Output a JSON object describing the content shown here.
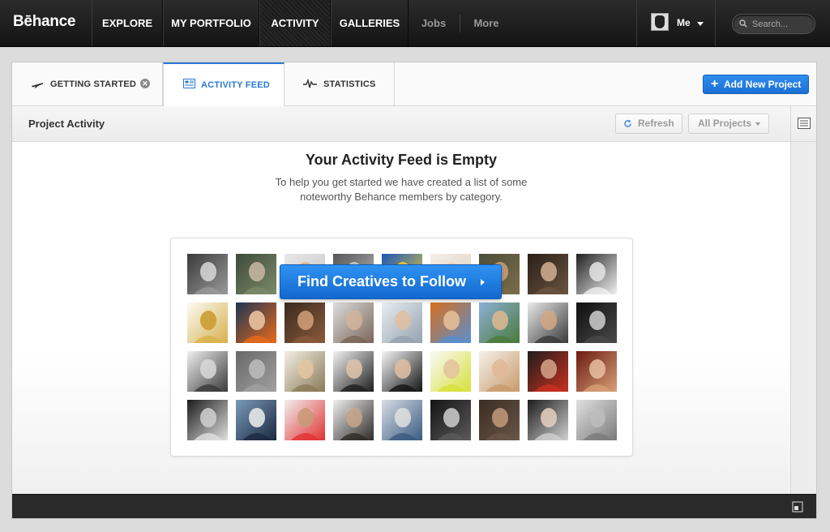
{
  "nav": {
    "logo": "Bēhance",
    "items": [
      {
        "label": "EXPLORE"
      },
      {
        "label": "MY PORTFOLIO"
      },
      {
        "label": "ACTIVITY"
      },
      {
        "label": "GALLERIES"
      },
      {
        "label": "Jobs"
      },
      {
        "label": "More"
      }
    ],
    "user_label": "Me",
    "search_placeholder": "Search..."
  },
  "tabs": [
    {
      "label": "GETTING STARTED"
    },
    {
      "label": "ACTIVITY FEED"
    },
    {
      "label": "STATISTICS"
    }
  ],
  "add_button": "Add New Project",
  "subbar": {
    "title": "Project Activity",
    "refresh": "Refresh",
    "filter": "All Projects"
  },
  "empty": {
    "heading": "Your Activity Feed is Empty",
    "line1": "To help you get started we have created a list of some",
    "line2": "noteworthy Behance members by category."
  },
  "cta": "Find Creatives to Follow",
  "colors": {
    "accent": "#2a78d8",
    "button_blue": "#1a6fd3",
    "nav_bg": "#1c1c1c"
  },
  "avatars": [
    {
      "c1": "#3a3a3a",
      "c2": "#9a9a9a",
      "skin": "#d8d8d8"
    },
    {
      "c1": "#3f4a3a",
      "c2": "#7c8a6a",
      "skin": "#c9b9a4"
    },
    {
      "c1": "#e8e8e8",
      "c2": "#c8c8c8",
      "skin": "#d9b48e"
    },
    {
      "c1": "#555555",
      "c2": "#bcbcbc",
      "skin": "#cfcfcf"
    },
    {
      "c1": "#1c56b8",
      "c2": "#f0d23a",
      "skin": "#f2d02f"
    },
    {
      "c1": "#f2eee8",
      "c2": "#e2d4c4",
      "skin": "#ecd8c6"
    },
    {
      "c1": "#4e4e3a",
      "c2": "#7a6e4a",
      "skin": "#caa07a"
    },
    {
      "c1": "#2a1f18",
      "c2": "#6a5440",
      "skin": "#d2b092"
    },
    {
      "c1": "#202020",
      "c2": "#f0f0f0",
      "skin": "#e5e5e5"
    },
    {
      "c1": "#fbfbf7",
      "c2": "#d7b04a",
      "skin": "#c99a2c"
    },
    {
      "c1": "#1e3552",
      "c2": "#e86a1c",
      "skin": "#f0c9a8"
    },
    {
      "c1": "#3b2a20",
      "c2": "#8a5a3a",
      "skin": "#d4a07a"
    },
    {
      "c1": "#dcdcdc",
      "c2": "#7a6658",
      "skin": "#d4b49a"
    },
    {
      "c1": "#e7edf2",
      "c2": "#95a2ae",
      "skin": "#e0c0a0"
    },
    {
      "c1": "#d66f1c",
      "c2": "#5a8fd0",
      "skin": "#e8c29a"
    },
    {
      "c1": "#8cb0d8",
      "c2": "#4a7a3a",
      "skin": "#e0b890"
    },
    {
      "c1": "#e9e9e9",
      "c2": "#3a3a3a",
      "skin": "#d2a884"
    },
    {
      "c1": "#0e0e0e",
      "c2": "#4a4a4a",
      "skin": "#cfcfcf"
    },
    {
      "c1": "#f0f0f0",
      "c2": "#3a3a3a",
      "skin": "#d9d9d9"
    },
    {
      "c1": "#686868",
      "c2": "#a0a0a0",
      "skin": "#bdbdbd"
    },
    {
      "c1": "#f2efe4",
      "c2": "#8a7a58",
      "skin": "#e4c6a0"
    },
    {
      "c1": "#f3f3f3",
      "c2": "#1e1e1e",
      "skin": "#e0c4aa"
    },
    {
      "c1": "#f7f7f7",
      "c2": "#141414",
      "skin": "#e2c0a2"
    },
    {
      "c1": "#fafafa",
      "c2": "#d7e03a",
      "skin": "#e4c29c"
    },
    {
      "c1": "#f5f0ea",
      "c2": "#c89a6a",
      "skin": "#e2b896"
    },
    {
      "c1": "#1f1d1d",
      "c2": "#c83020",
      "skin": "#d6a48a"
    },
    {
      "c1": "#6a1a10",
      "c2": "#d8a078",
      "skin": "#e8c0a0"
    },
    {
      "c1": "#1a1a1a",
      "c2": "#e0e0e0",
      "skin": "#d0d0d0"
    },
    {
      "c1": "#7a9ab8",
      "c2": "#1b2840",
      "skin": "#f0f0f0"
    },
    {
      "c1": "#f0f0f0",
      "c2": "#e23232",
      "skin": "#c89a78"
    },
    {
      "c1": "#efefef",
      "c2": "#2e2a26",
      "skin": "#c8a48a"
    },
    {
      "c1": "#d8dee6",
      "c2": "#3a5a80",
      "skin": "#e0e0e0"
    },
    {
      "c1": "#141414",
      "c2": "#5a5a5a",
      "skin": "#cfcfcf"
    },
    {
      "c1": "#3a2c22",
      "c2": "#6a5648",
      "skin": "#c49a7a"
    },
    {
      "c1": "#1b1b1b",
      "c2": "#d0d0d0",
      "skin": "#e6d0c0"
    },
    {
      "c1": "#e0e0e0",
      "c2": "#7a7a7a",
      "skin": "#bdbdbd"
    }
  ]
}
